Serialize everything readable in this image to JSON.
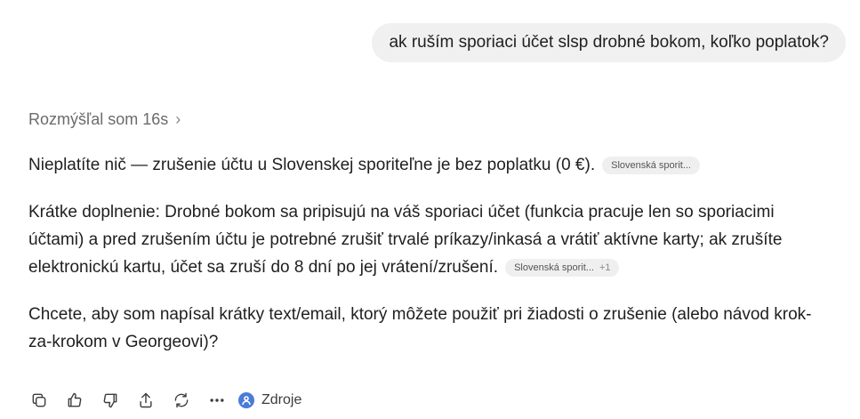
{
  "user_message": "ak ruším sporiaci účet slsp drobné bokom, koľko poplatok?",
  "thought": {
    "label": "Rozmýšľal som 16s",
    "chevron": "›"
  },
  "answer": {
    "p1": "Nieplatíte nič — zrušenie účtu u Slovenskej sporiteľne je bez poplatku (0 €).",
    "p1_chip": "Slovenská sporit...",
    "p2": "Krátke doplnenie: Drobné bokom sa pripisujú na váš sporiaci účet (funkcia pracuje len so sporiacimi účtami) a pred zrušením účtu je potrebné zrušiť trvalé príkazy/inkasá a vrátiť aktívne karty; ak zrušíte elektronickú kartu, účet sa zruší do 8 dní po jej vrátení/zrušení.",
    "p2_chip": "Slovenská sporit...",
    "p2_chip_extra": "+1",
    "p3": "Chcete, aby som napísal krátky text/email, ktorý môžete použiť pri žiadosti o zrušenie (alebo návod krok-za-krokom v Georgeovi)?"
  },
  "toolbar": {
    "icons": [
      "copy-icon",
      "thumbs-up-icon",
      "thumbs-down-icon",
      "share-icon",
      "regenerate-icon",
      "more-icon"
    ],
    "sources_label": "Zdroje"
  }
}
